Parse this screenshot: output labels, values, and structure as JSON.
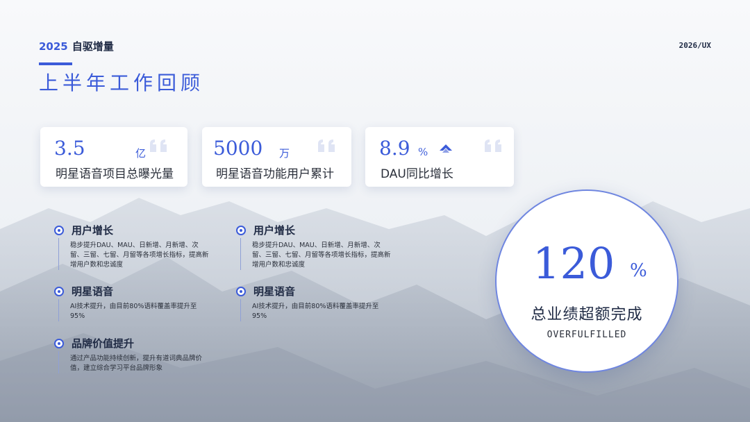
{
  "header": {
    "year": "2025",
    "subtitle": "自驱增量",
    "corner": "2026/UX"
  },
  "title": "上半年工作回顾",
  "colors": {
    "accent": "#3b5bd9",
    "text": "#1f2a44"
  },
  "cards": [
    {
      "value": "3.5",
      "unit": "亿",
      "label": "明星语音项目总曝光量",
      "icon": "quote-icon"
    },
    {
      "value": "5000",
      "unit": "万",
      "label": "明星语音功能用户累计",
      "icon": "quote-icon"
    },
    {
      "value": "8.9",
      "unit": "%",
      "label": "DAU同比增长",
      "icon": "up-arrow-icon"
    }
  ],
  "left_items": [
    {
      "title": "用户增长",
      "desc": "稳步提升DAU、MAU、日新增、月新增、次留、三留、七留、月留等各项增长指标，提高新增用户数和忠诚度"
    },
    {
      "title": "明星语音",
      "desc": "AI技术提升，由目前80%语料覆盖率提升至95%"
    },
    {
      "title": "品牌价值提升",
      "desc": "通过产品功能持续创新，提升有道词典品牌价值，建立综合学习平台品牌形象"
    }
  ],
  "right_items": [
    {
      "title": "用户增长",
      "desc": "稳步提升DAU、MAU、日新增、月新增、次留、三留、七留、月留等各项增长指标，提高新增用户数和忠诚度"
    },
    {
      "title": "明星语音",
      "desc": "AI技术提升，由目前80%语料覆盖率提升至95%"
    }
  ],
  "highlight": {
    "value": "120",
    "unit": "%",
    "caption": "总业绩超额完成",
    "sub": "OVERFULFILLED"
  }
}
